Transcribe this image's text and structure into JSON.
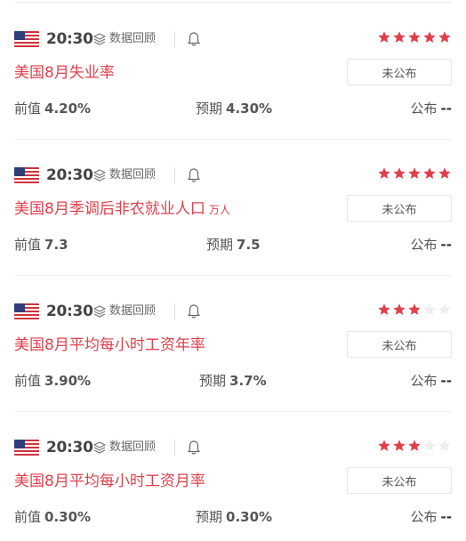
{
  "items": [
    {
      "time": "20:30",
      "review_label": "数据回顾",
      "stars_filled": 5,
      "stars_total": 5,
      "title": "美国8月失业率",
      "unit": "",
      "status": "未公布",
      "previous_label": "前值",
      "previous_value": "4.20%",
      "forecast_label": "预期",
      "forecast_value": "4.30%",
      "actual_label": "公布",
      "actual_value": "--"
    },
    {
      "time": "20:30",
      "review_label": "数据回顾",
      "stars_filled": 5,
      "stars_total": 5,
      "title": "美国8月季调后非农就业人口",
      "unit": "万人",
      "status": "未公布",
      "previous_label": "前值",
      "previous_value": "7.3",
      "forecast_label": "预期",
      "forecast_value": "7.5",
      "actual_label": "公布",
      "actual_value": "--"
    },
    {
      "time": "20:30",
      "review_label": "数据回顾",
      "stars_filled": 3,
      "stars_total": 5,
      "title": "美国8月平均每小时工资年率",
      "unit": "",
      "status": "未公布",
      "previous_label": "前值",
      "previous_value": "3.90%",
      "forecast_label": "预期",
      "forecast_value": "3.7%",
      "actual_label": "公布",
      "actual_value": "--"
    },
    {
      "time": "20:30",
      "review_label": "数据回顾",
      "stars_filled": 3,
      "stars_total": 5,
      "title": "美国8月平均每小时工资月率",
      "unit": "",
      "status": "未公布",
      "previous_label": "前值",
      "previous_value": "0.30%",
      "forecast_label": "预期",
      "forecast_value": "0.30%",
      "actual_label": "公布",
      "actual_value": "--"
    }
  ],
  "colors": {
    "title": "#e0404b",
    "star_filled": "#e0404b",
    "star_empty": "#eeeeee"
  },
  "icons": {
    "flag": "us-flag-icon",
    "review": "layers-icon",
    "alert": "bell-icon",
    "rating": "star-icon"
  }
}
